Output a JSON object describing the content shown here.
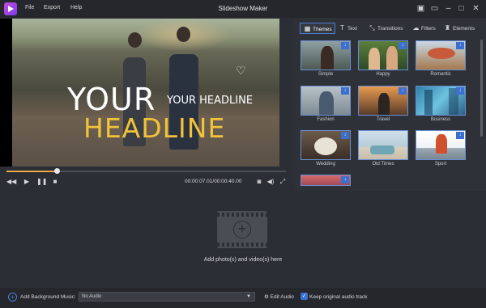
{
  "window": {
    "title": "Slideshow Maker",
    "menu": [
      "File",
      "Export",
      "Help"
    ]
  },
  "preview": {
    "headline_big": "YOUR",
    "headline_small": "YOUR HEADLINE",
    "headline_yellow": "HEADLINE",
    "timecode": "00:00:07.01/00:00:40.00",
    "progress": 0.18
  },
  "tabs": [
    "Themes",
    "Text",
    "Transitions",
    "Filters",
    "Elements"
  ],
  "themes": [
    {
      "label": "Simple"
    },
    {
      "label": "Happy"
    },
    {
      "label": "Romantic"
    },
    {
      "label": "Fashion"
    },
    {
      "label": "Travel"
    },
    {
      "label": "Business"
    },
    {
      "label": "Wedding"
    },
    {
      "label": "Old Times"
    },
    {
      "label": "Sport"
    }
  ],
  "drop_area": {
    "label": "Add photo(s) and video(s) here"
  },
  "bottom": {
    "bgm_label": "Add Background Music:",
    "audio_select": "No Audio",
    "edit_audio": "Edit Audio",
    "keep_original": "Keep original audio track",
    "keep_checked": true
  },
  "colors": {
    "accent": "#4c7ed8",
    "headline_yellow": "#f2c23a",
    "progress": "#f0a64a"
  }
}
